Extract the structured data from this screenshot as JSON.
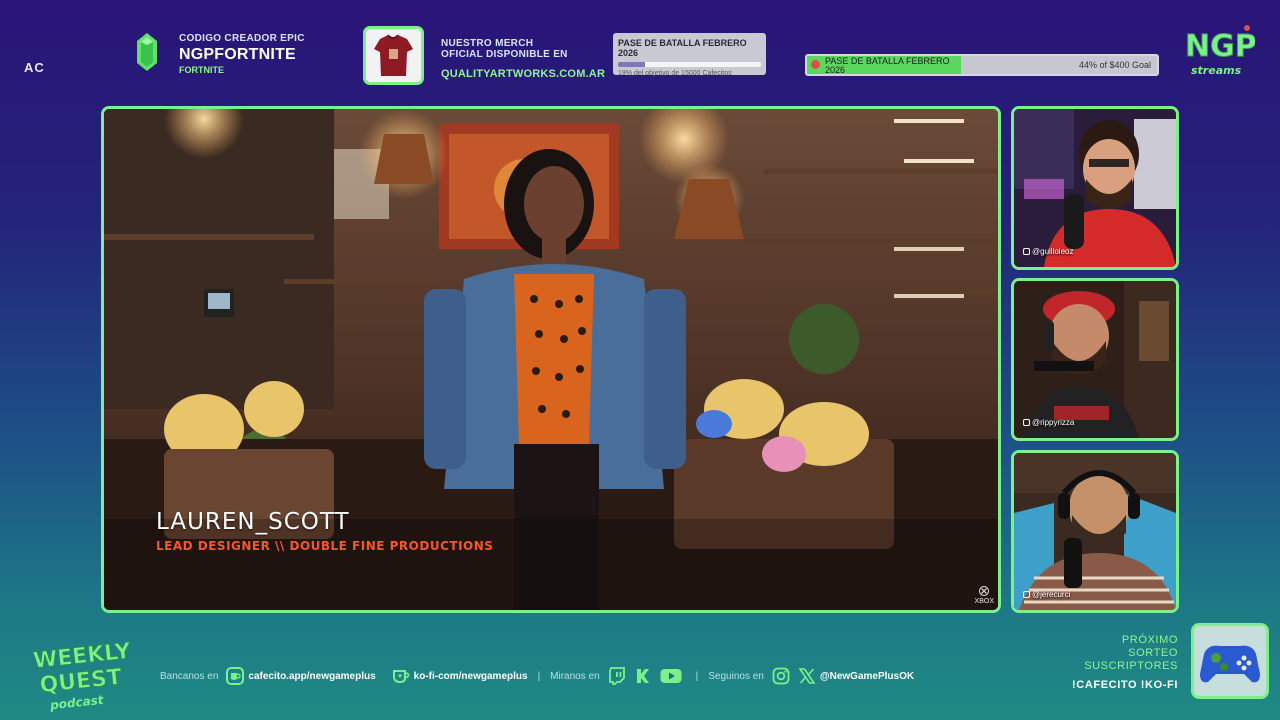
{
  "header": {
    "ac_logo": "AC",
    "epic": {
      "small": "CODIGO CREADOR EPIC",
      "code": "NGPFORTNITE",
      "game": "FORTNITE"
    },
    "merch": {
      "line1": "NUESTRO MERCH",
      "line2": "OFICIAL DISPONIBLE EN",
      "url": "QUALITYARTWORKS.COM.AR"
    },
    "goal_card": {
      "title": "PASE DE BATALLA FEBRERO 2026",
      "subtitle": "19% del objetivo de 15000 Cafecitos",
      "progress": 0.19
    },
    "goal_bar": {
      "label": "PASE DE BATALLA FEBRERO 2026",
      "right_text": "44% of $400 Goal",
      "progress": 0.44
    },
    "brand_logo": {
      "line1": "NGP",
      "line2": "streams"
    }
  },
  "main_video": {
    "speaker_name": "LAUREN_SCOTT",
    "speaker_role": "LEAD DESIGNER \\\\ DOUBLE FINE PRODUCTIONS",
    "watermark": "XBOX"
  },
  "cams": [
    {
      "handle": "@guilloleoz"
    },
    {
      "handle": "@rippyrizza"
    },
    {
      "handle": "@jerecurci"
    }
  ],
  "footer": {
    "show_logo": {
      "line1": "WEEKLY",
      "line2": "QUEST",
      "line3": "podcast"
    },
    "banc_label": "Bancanos en",
    "cafecito": "cafecito.app/newgameplus",
    "kofi": "ko-fi-com/newgameplus",
    "sep": "|",
    "miranos_label": "Miranos en",
    "seguinos_label": "Seguinos en",
    "handle": "@NewGamePlusOK",
    "sorteo": {
      "line1": "PRÓXIMO",
      "line2": "SORTEO",
      "line3": "SUSCRIPTORES",
      "commands": "!CAFECITO  !KO-FI"
    }
  },
  "colors": {
    "accent_green": "#7cf08a",
    "role_orange": "#f4572a",
    "bg_top": "#2a1478",
    "bg_bottom": "#1f8a84"
  }
}
